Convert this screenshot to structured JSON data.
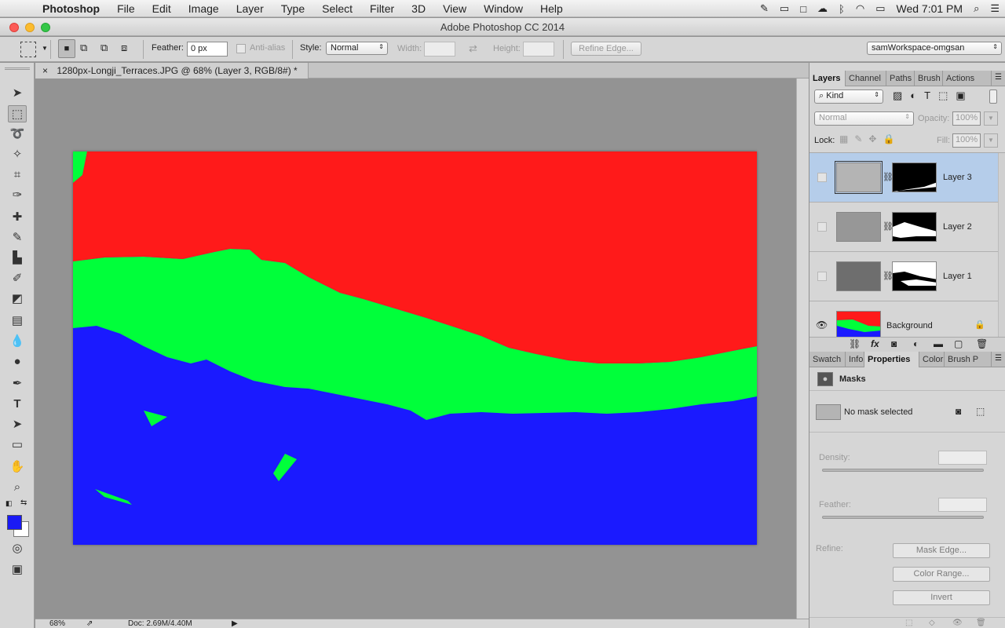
{
  "menubar": {
    "app_name": "Photoshop",
    "items": [
      "File",
      "Edit",
      "Image",
      "Layer",
      "Type",
      "Select",
      "Filter",
      "3D",
      "View",
      "Window",
      "Help"
    ],
    "clock": "Wed 7:01 PM"
  },
  "window": {
    "title": "Adobe Photoshop CC 2014"
  },
  "options": {
    "feather_label": "Feather:",
    "feather_value": "0 px",
    "antialias_label": "Anti-alias",
    "style_label": "Style:",
    "style_value": "Normal",
    "width_label": "Width:",
    "height_label": "Height:",
    "refine_edge": "Refine Edge...",
    "workspace": "samWorkspace-omgsan"
  },
  "document": {
    "tab_title": "1280px-Longji_Terraces.JPG @ 68% (Layer 3, RGB/8#) *",
    "zoom": "68%",
    "doc_info": "Doc: 2.69M/4.40M"
  },
  "layers_panel": {
    "tabs": [
      "Layers",
      "Channel",
      "Paths",
      "Brush",
      "Actions"
    ],
    "kind": "Kind",
    "blend_mode": "Normal",
    "opacity_label": "Opacity:",
    "opacity_value": "100%",
    "lock_label": "Lock:",
    "fill_label": "Fill:",
    "fill_value": "100%",
    "layers": [
      {
        "name": "Layer 3",
        "selected": true
      },
      {
        "name": "Layer 2",
        "selected": false
      },
      {
        "name": "Layer 1",
        "selected": false
      },
      {
        "name": "Background",
        "selected": false
      }
    ]
  },
  "properties_panel": {
    "tabs": [
      "Swatch",
      "Info",
      "Properties",
      "Color",
      "Brush P"
    ],
    "header": "Masks",
    "mask_status": "No mask selected",
    "density_label": "Density:",
    "feather_label": "Feather:",
    "refine_label": "Refine:",
    "mask_edge": "Mask Edge...",
    "color_range": "Color Range...",
    "invert": "Invert"
  },
  "colors": {
    "foreground": "#1a1af5",
    "background": "#ffffff",
    "image_red": "#ff1a1a",
    "image_green": "#00ff3a",
    "image_blue": "#1a1aff",
    "selection": "#b5cdea"
  }
}
